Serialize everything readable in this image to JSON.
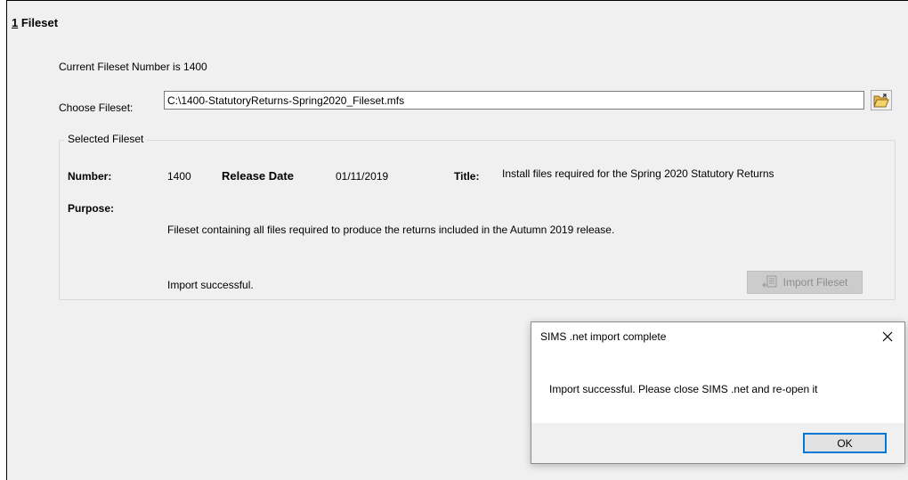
{
  "section": {
    "mnemonic": "1",
    "title_rest": " Fileset"
  },
  "current_fileset_text": "Current Fileset Number is 1400",
  "choose": {
    "label": "Choose Fileset:",
    "path_value": "C:\\1400-StatutoryReturns-Spring2020_Fileset.mfs",
    "browse_icon": "open-folder-icon"
  },
  "selected": {
    "legend": "Selected Fileset",
    "number_label": "Number:",
    "number_value": "1400",
    "release_label": "Release Date",
    "release_value": "01/11/2019",
    "title_label": "Title:",
    "title_value": "Install files required for the Spring 2020 Statutory Returns",
    "purpose_label": "Purpose:",
    "purpose_value": "Fileset containing all files required to produce the returns included in the Autumn 2019 release.",
    "status": "Import successful.",
    "import_button": "Import Fileset",
    "import_icon": "import-icon"
  },
  "dialog": {
    "title": "SIMS .net import complete",
    "message": "Import successful. Please close SIMS .net and re-open it",
    "ok": "OK",
    "close_icon": "close-icon"
  },
  "colors": {
    "panel_bg": "#f0f0f0",
    "ok_border": "#0078d7",
    "disabled_text": "#8c8c8c"
  }
}
